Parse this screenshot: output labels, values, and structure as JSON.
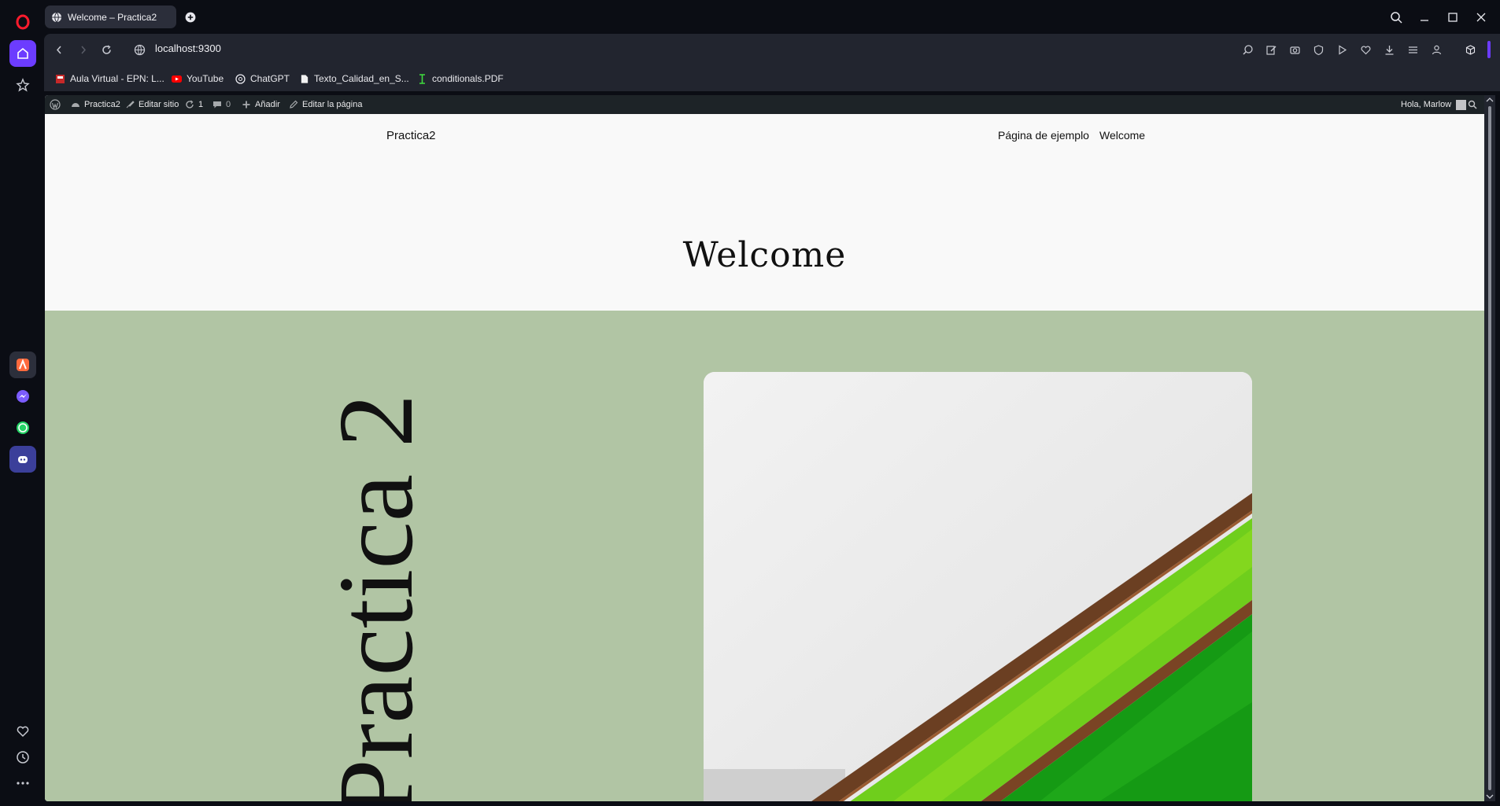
{
  "browser": {
    "tab_title": "Welcome – Practica2",
    "url": "localhost:9300",
    "bookmarks": [
      {
        "label": "Aula Virtual - EPN: L...",
        "icon": "epn-favicon"
      },
      {
        "label": "YouTube",
        "icon": "youtube-icon"
      },
      {
        "label": "ChatGPT",
        "icon": "chatgpt-icon"
      },
      {
        "label": "Texto_Calidad_en_S...",
        "icon": "document-icon"
      },
      {
        "label": "conditionals.PDF",
        "icon": "pdf-cursor-icon"
      }
    ],
    "sidebar_apps": [
      "aria-icon",
      "messenger-icon",
      "whatsapp-icon",
      "discord-icon"
    ],
    "accent_color": "#6c3cff"
  },
  "wp_admin_bar": {
    "site_name": "Practica2",
    "edit_site": "Editar sitio",
    "updates_count": "1",
    "comments_count": "0",
    "add_new": "Añadir",
    "edit_page": "Editar la página",
    "greeting": "Hola, Marlow"
  },
  "site": {
    "title": "Practica2",
    "nav": [
      "Página de ejemplo",
      "Welcome"
    ],
    "page_title": "Welcome",
    "cover_vertical_text": "Practica 2",
    "cover_color": "#b1c5a4"
  }
}
